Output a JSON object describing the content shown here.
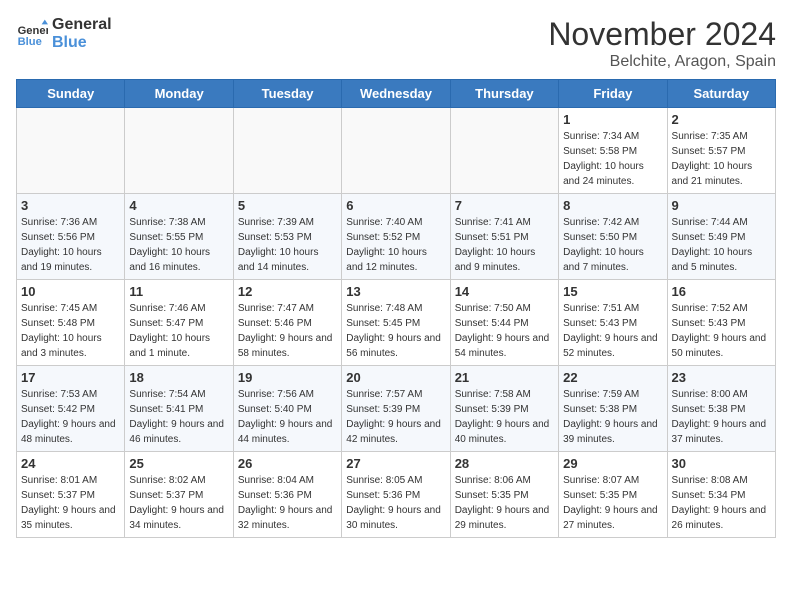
{
  "logo": {
    "line1": "General",
    "line2": "Blue"
  },
  "header": {
    "month": "November 2024",
    "location": "Belchite, Aragon, Spain"
  },
  "weekdays": [
    "Sunday",
    "Monday",
    "Tuesday",
    "Wednesday",
    "Thursday",
    "Friday",
    "Saturday"
  ],
  "weeks": [
    [
      {
        "day": "",
        "info": ""
      },
      {
        "day": "",
        "info": ""
      },
      {
        "day": "",
        "info": ""
      },
      {
        "day": "",
        "info": ""
      },
      {
        "day": "",
        "info": ""
      },
      {
        "day": "1",
        "info": "Sunrise: 7:34 AM\nSunset: 5:58 PM\nDaylight: 10 hours and 24 minutes."
      },
      {
        "day": "2",
        "info": "Sunrise: 7:35 AM\nSunset: 5:57 PM\nDaylight: 10 hours and 21 minutes."
      }
    ],
    [
      {
        "day": "3",
        "info": "Sunrise: 7:36 AM\nSunset: 5:56 PM\nDaylight: 10 hours and 19 minutes."
      },
      {
        "day": "4",
        "info": "Sunrise: 7:38 AM\nSunset: 5:55 PM\nDaylight: 10 hours and 16 minutes."
      },
      {
        "day": "5",
        "info": "Sunrise: 7:39 AM\nSunset: 5:53 PM\nDaylight: 10 hours and 14 minutes."
      },
      {
        "day": "6",
        "info": "Sunrise: 7:40 AM\nSunset: 5:52 PM\nDaylight: 10 hours and 12 minutes."
      },
      {
        "day": "7",
        "info": "Sunrise: 7:41 AM\nSunset: 5:51 PM\nDaylight: 10 hours and 9 minutes."
      },
      {
        "day": "8",
        "info": "Sunrise: 7:42 AM\nSunset: 5:50 PM\nDaylight: 10 hours and 7 minutes."
      },
      {
        "day": "9",
        "info": "Sunrise: 7:44 AM\nSunset: 5:49 PM\nDaylight: 10 hours and 5 minutes."
      }
    ],
    [
      {
        "day": "10",
        "info": "Sunrise: 7:45 AM\nSunset: 5:48 PM\nDaylight: 10 hours and 3 minutes."
      },
      {
        "day": "11",
        "info": "Sunrise: 7:46 AM\nSunset: 5:47 PM\nDaylight: 10 hours and 1 minute."
      },
      {
        "day": "12",
        "info": "Sunrise: 7:47 AM\nSunset: 5:46 PM\nDaylight: 9 hours and 58 minutes."
      },
      {
        "day": "13",
        "info": "Sunrise: 7:48 AM\nSunset: 5:45 PM\nDaylight: 9 hours and 56 minutes."
      },
      {
        "day": "14",
        "info": "Sunrise: 7:50 AM\nSunset: 5:44 PM\nDaylight: 9 hours and 54 minutes."
      },
      {
        "day": "15",
        "info": "Sunrise: 7:51 AM\nSunset: 5:43 PM\nDaylight: 9 hours and 52 minutes."
      },
      {
        "day": "16",
        "info": "Sunrise: 7:52 AM\nSunset: 5:43 PM\nDaylight: 9 hours and 50 minutes."
      }
    ],
    [
      {
        "day": "17",
        "info": "Sunrise: 7:53 AM\nSunset: 5:42 PM\nDaylight: 9 hours and 48 minutes."
      },
      {
        "day": "18",
        "info": "Sunrise: 7:54 AM\nSunset: 5:41 PM\nDaylight: 9 hours and 46 minutes."
      },
      {
        "day": "19",
        "info": "Sunrise: 7:56 AM\nSunset: 5:40 PM\nDaylight: 9 hours and 44 minutes."
      },
      {
        "day": "20",
        "info": "Sunrise: 7:57 AM\nSunset: 5:39 PM\nDaylight: 9 hours and 42 minutes."
      },
      {
        "day": "21",
        "info": "Sunrise: 7:58 AM\nSunset: 5:39 PM\nDaylight: 9 hours and 40 minutes."
      },
      {
        "day": "22",
        "info": "Sunrise: 7:59 AM\nSunset: 5:38 PM\nDaylight: 9 hours and 39 minutes."
      },
      {
        "day": "23",
        "info": "Sunrise: 8:00 AM\nSunset: 5:38 PM\nDaylight: 9 hours and 37 minutes."
      }
    ],
    [
      {
        "day": "24",
        "info": "Sunrise: 8:01 AM\nSunset: 5:37 PM\nDaylight: 9 hours and 35 minutes."
      },
      {
        "day": "25",
        "info": "Sunrise: 8:02 AM\nSunset: 5:37 PM\nDaylight: 9 hours and 34 minutes."
      },
      {
        "day": "26",
        "info": "Sunrise: 8:04 AM\nSunset: 5:36 PM\nDaylight: 9 hours and 32 minutes."
      },
      {
        "day": "27",
        "info": "Sunrise: 8:05 AM\nSunset: 5:36 PM\nDaylight: 9 hours and 30 minutes."
      },
      {
        "day": "28",
        "info": "Sunrise: 8:06 AM\nSunset: 5:35 PM\nDaylight: 9 hours and 29 minutes."
      },
      {
        "day": "29",
        "info": "Sunrise: 8:07 AM\nSunset: 5:35 PM\nDaylight: 9 hours and 27 minutes."
      },
      {
        "day": "30",
        "info": "Sunrise: 8:08 AM\nSunset: 5:34 PM\nDaylight: 9 hours and 26 minutes."
      }
    ]
  ]
}
